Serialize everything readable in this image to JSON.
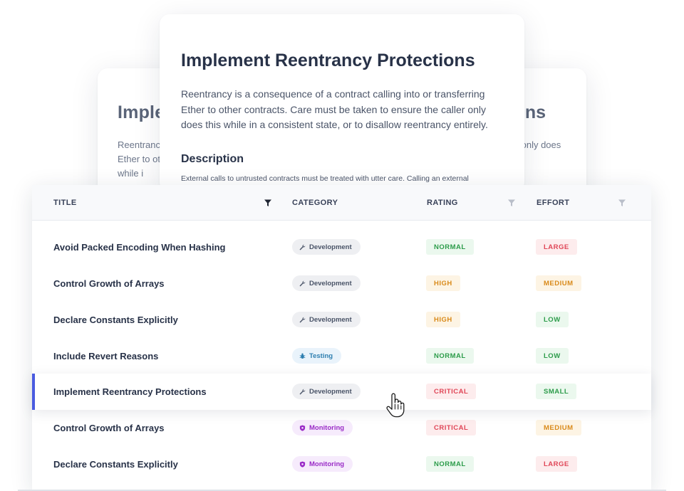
{
  "back_card": {
    "title_left": "Imple",
    "title_right": "ns",
    "body_left": "Reentranc Ether to ot this while i",
    "body_right": "rring only does"
  },
  "front_card": {
    "title": "Implement Reentrancy Protections",
    "body": "Reentrancy is a consequence of a contract calling into or transferring Ether to other contracts. Care must be taken to ensure the caller only does this while in a consistent state, or to disallow reentrancy entirely.",
    "subheading": "Description",
    "description": "External calls to untrusted contracts must be treated with utter care. Calling an external"
  },
  "table": {
    "columns": {
      "title": "TITLE",
      "category": "CATEGORY",
      "rating": "RATING",
      "effort": "EFFORT"
    },
    "rows": [
      {
        "title": "Avoid Packed Encoding When Hashing",
        "category": "Development",
        "rating": "NORMAL",
        "effort": "LARGE"
      },
      {
        "title": "Control Growth of Arrays",
        "category": "Development",
        "rating": "HIGH",
        "effort": "MEDIUM"
      },
      {
        "title": "Declare Constants Explicitly",
        "category": "Development",
        "rating": "HIGH",
        "effort": "LOW"
      },
      {
        "title": "Include Revert Reasons",
        "category": "Testing",
        "rating": "NORMAL",
        "effort": "LOW"
      },
      {
        "title": "Implement Reentrancy Protections",
        "category": "Development",
        "rating": "CRITICAL",
        "effort": "SMALL"
      },
      {
        "title": "Control Growth of Arrays",
        "category": "Monitoring",
        "rating": "CRITICAL",
        "effort": "MEDIUM"
      },
      {
        "title": "Declare Constants Explicitly",
        "category": "Monitoring",
        "rating": "NORMAL",
        "effort": "LARGE"
      }
    ]
  },
  "colors": {
    "accent": "#4a5be0",
    "green": "#2c9c4a",
    "orange": "#d98a1a",
    "red": "#e04657",
    "testing": "#2e7fb0",
    "monitoring": "#9a2bc7"
  }
}
